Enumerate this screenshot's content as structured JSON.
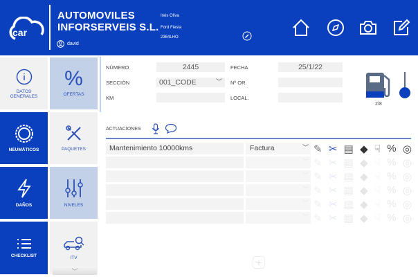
{
  "header": {
    "logo_text": "car",
    "company_line1": "AUTOMOVILES",
    "company_line2": "INFORSERVEIS S.L.",
    "user": "david",
    "customer": "Inés Oliva",
    "vehicle": "Ford Fiesta",
    "plate": "2364LHO"
  },
  "sidebar": {
    "left": [
      {
        "label": "DATOS GENERALES",
        "icon": "info-icon"
      },
      {
        "label": "NEUMÁTICOS",
        "icon": "tire-icon"
      },
      {
        "label": "DAÑOS",
        "icon": "lightning-icon"
      },
      {
        "label": "CHECKLIST",
        "icon": "list-icon"
      }
    ],
    "right": [
      {
        "label": "OFERTAS",
        "icon": "percent-icon"
      },
      {
        "label": "PAQUETES",
        "icon": "tools-icon"
      },
      {
        "label": "NIVELES",
        "icon": "sliders-icon"
      },
      {
        "label": "ITV",
        "icon": "car-search-icon"
      }
    ]
  },
  "form": {
    "numero_label": "NÚMERO",
    "numero": "2445",
    "fecha_label": "FECHA",
    "fecha": "25/1/22",
    "seccion_label": "SECCIÓN",
    "seccion": "001_CODE",
    "nor_label": "Nº OR",
    "nor": "",
    "km_label": "KM",
    "km": "",
    "local_label": "LOCAL.",
    "local": ""
  },
  "fuel": {
    "level_text": "2/8",
    "level": 0.25
  },
  "actuaciones": {
    "label": "ACTUACIONES",
    "rows": [
      {
        "name": "Mantenimiento 10000kms",
        "type": "Factura"
      },
      {
        "name": "",
        "type": ""
      },
      {
        "name": "",
        "type": ""
      },
      {
        "name": "",
        "type": ""
      },
      {
        "name": "",
        "type": ""
      },
      {
        "name": "",
        "type": ""
      }
    ]
  },
  "colors": {
    "primary": "#0a40bd",
    "selected": "#c2d0e8"
  }
}
